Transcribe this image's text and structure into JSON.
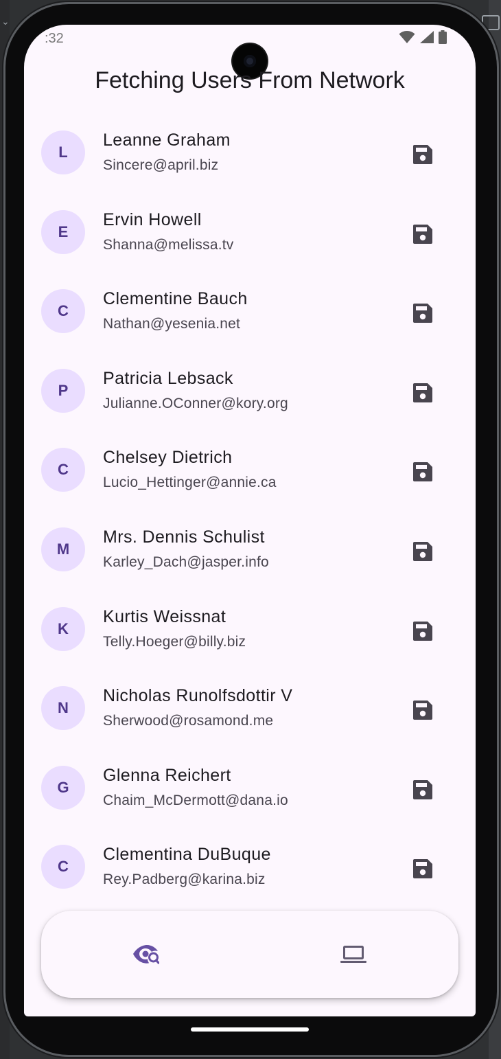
{
  "status_bar": {
    "time": ":32",
    "icons": [
      "wifi-icon",
      "cell-signal-icon",
      "battery-icon"
    ]
  },
  "app_bar": {
    "title": "Fetching Users From Network"
  },
  "users": [
    {
      "initial": "L",
      "name": "Leanne Graham",
      "email": "Sincere@april.biz"
    },
    {
      "initial": "E",
      "name": "Ervin Howell",
      "email": "Shanna@melissa.tv"
    },
    {
      "initial": "C",
      "name": "Clementine Bauch",
      "email": "Nathan@yesenia.net"
    },
    {
      "initial": "P",
      "name": "Patricia Lebsack",
      "email": "Julianne.OConner@kory.org"
    },
    {
      "initial": "C",
      "name": "Chelsey Dietrich",
      "email": "Lucio_Hettinger@annie.ca"
    },
    {
      "initial": "M",
      "name": "Mrs. Dennis Schulist",
      "email": "Karley_Dach@jasper.info"
    },
    {
      "initial": "K",
      "name": "Kurtis Weissnat",
      "email": "Telly.Hoeger@billy.biz"
    },
    {
      "initial": "N",
      "name": "Nicholas Runolfsdottir V",
      "email": "Sherwood@rosamond.me"
    },
    {
      "initial": "G",
      "name": "Glenna Reichert",
      "email": "Chaim_McDermott@dana.io"
    },
    {
      "initial": "C",
      "name": "Clementina DuBuque",
      "email": "Rey.Padberg@karina.biz"
    }
  ],
  "row_action_icon": "save-icon",
  "bottom_nav": {
    "items": [
      {
        "icon": "eye-search-icon",
        "selected": true
      },
      {
        "icon": "laptop-icon",
        "selected": false
      }
    ]
  },
  "colors": {
    "background": "#fdf7fe",
    "avatar_bg": "#eaddff",
    "avatar_text": "#4f378a",
    "icon": "#49454f",
    "nav_selected": "#6750a4",
    "nav_unselected": "#625b71"
  }
}
